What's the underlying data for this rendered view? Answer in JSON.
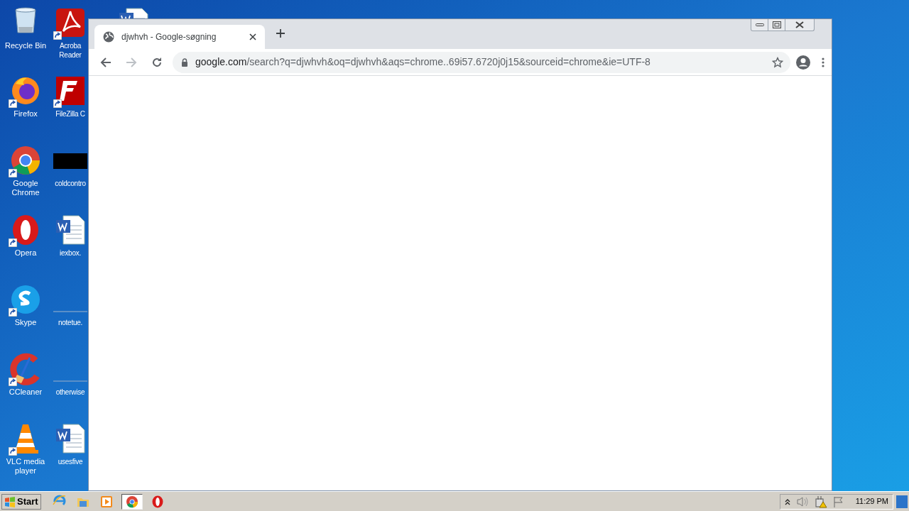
{
  "desktop": {
    "columns": [
      [
        {
          "label": "Recycle Bin",
          "kind": "recycle",
          "shortcut": false
        },
        {
          "label": "Firefox",
          "kind": "firefox",
          "shortcut": true
        },
        {
          "label": "Google Chrome",
          "kind": "chrome",
          "shortcut": true
        },
        {
          "label": "Opera",
          "kind": "opera",
          "shortcut": true
        },
        {
          "label": "Skype",
          "kind": "skype",
          "shortcut": true
        },
        {
          "label": "CCleaner",
          "kind": "ccleaner",
          "shortcut": true
        },
        {
          "label": "VLC media player",
          "kind": "vlc",
          "shortcut": true
        }
      ],
      [
        {
          "label": "Acroba Reader",
          "kind": "acrobat",
          "shortcut": true
        },
        {
          "label": "FileZilla C",
          "kind": "filezilla",
          "shortcut": true
        },
        {
          "label": "coldcontro",
          "kind": "black",
          "shortcut": false
        },
        {
          "label": "iexbox.",
          "kind": "word",
          "shortcut": false
        },
        {
          "label": "notetue.",
          "kind": "blank",
          "shortcut": false
        },
        {
          "label": "otherwise",
          "kind": "blank",
          "shortcut": false
        },
        {
          "label": "usesfive",
          "kind": "word",
          "shortcut": false
        }
      ],
      [
        {
          "kind": "word",
          "shortcut": false
        }
      ]
    ]
  },
  "browser": {
    "tabs": [
      {
        "title": "djwhvh - Google-søgning",
        "selected": true
      }
    ],
    "address": {
      "host": "google.com",
      "path": "/search?q=djwhvh&oq=djwhvh&aqs=chrome..69i57.6720j0j15&sourceid=chrome&ie=UTF-8"
    }
  },
  "taskbar": {
    "start": "Start",
    "apps": [
      {
        "kind": "ie",
        "selected": false
      },
      {
        "kind": "folder",
        "selected": false
      },
      {
        "kind": "media",
        "selected": false
      },
      {
        "kind": "chrome",
        "selected": true
      },
      {
        "kind": "opera",
        "selected": false
      }
    ],
    "clock": "11:29 PM"
  }
}
